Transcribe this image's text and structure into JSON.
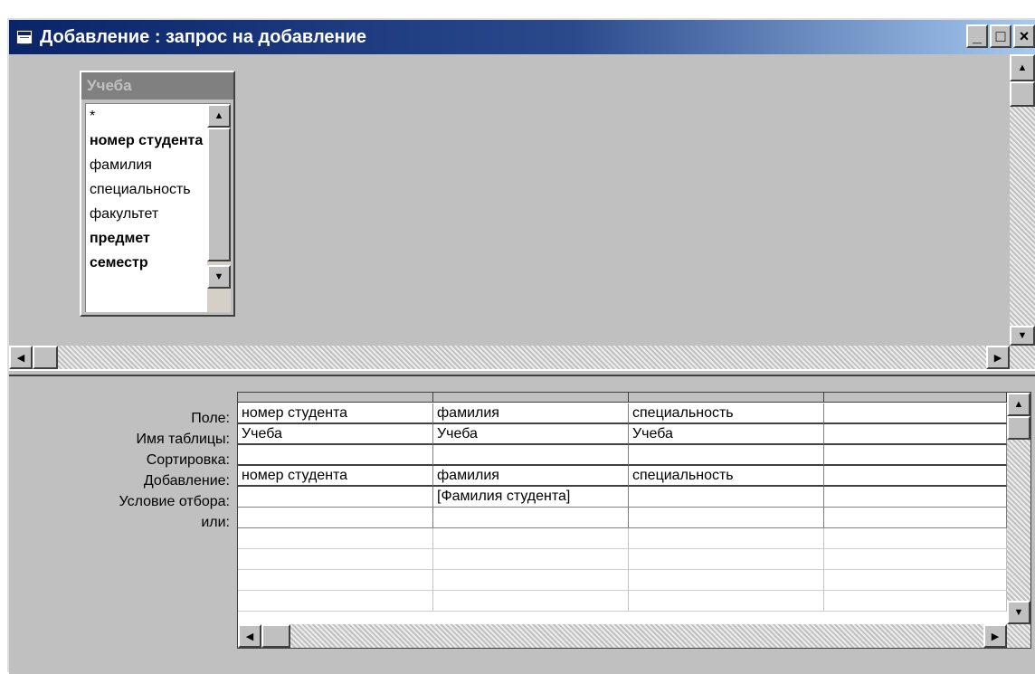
{
  "window": {
    "title": "Добавление : запрос на добавление",
    "minimize_glyph": "_",
    "maximize_glyph": "□",
    "close_glyph": "×"
  },
  "field_list": {
    "table_name": "Учеба",
    "items": [
      {
        "label": "*",
        "bold": false
      },
      {
        "label": "номер студента",
        "bold": true
      },
      {
        "label": "фамилия",
        "bold": false
      },
      {
        "label": "специальность",
        "bold": false
      },
      {
        "label": "факультет",
        "bold": false
      },
      {
        "label": "предмет",
        "bold": true
      },
      {
        "label": "семестр",
        "bold": true
      }
    ]
  },
  "grid": {
    "row_labels": [
      "Поле:",
      "Имя таблицы:",
      "Сортировка:",
      "Добавление:",
      "Условие отбора:",
      "или:"
    ],
    "columns": [
      {
        "field": "номер студента",
        "table": "Учеба",
        "sort": "",
        "append": "номер студента",
        "criteria": "",
        "or": ""
      },
      {
        "field": "фамилия",
        "table": "Учеба",
        "sort": "",
        "append": "фамилия",
        "criteria": "[Фамилия студента]",
        "or": ""
      },
      {
        "field": "специальность",
        "table": "Учеба",
        "sort": "",
        "append": "специальность",
        "criteria": "",
        "or": ""
      },
      {
        "field": "",
        "table": "",
        "sort": "",
        "append": "",
        "criteria": "",
        "or": ""
      }
    ]
  },
  "icons": {
    "window": "query-window-icon",
    "scroll_up": "arrow-up-icon",
    "scroll_down": "arrow-down-icon",
    "scroll_left": "arrow-left-icon",
    "scroll_right": "arrow-right-icon"
  }
}
